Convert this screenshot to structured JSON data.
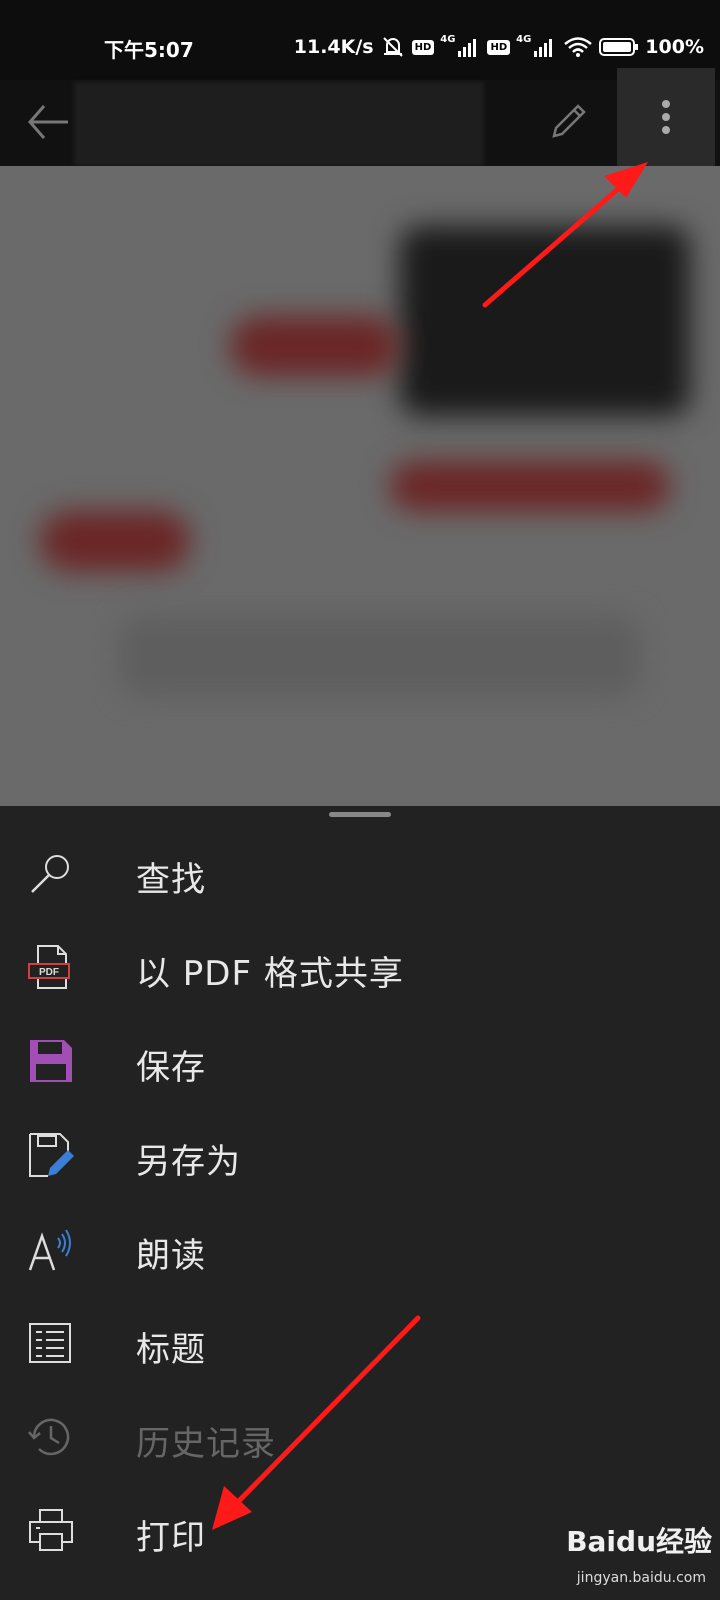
{
  "status_bar": {
    "time": "下午5:07",
    "net_speed": "11.4K/s",
    "hd_badge": "HD",
    "network_type": "4G",
    "battery_percent": "100%"
  },
  "toolbar": {
    "icons": [
      "back-arrow-icon",
      "pencil-icon",
      "more-vert-icon"
    ]
  },
  "menu": {
    "items": [
      {
        "label": "查找",
        "icon": "search-icon",
        "enabled": true
      },
      {
        "label": "以 PDF 格式共享",
        "icon": "pdf-icon",
        "enabled": true
      },
      {
        "label": "保存",
        "icon": "save-icon",
        "enabled": true
      },
      {
        "label": "另存为",
        "icon": "save-as-icon",
        "enabled": true
      },
      {
        "label": "朗读",
        "icon": "read-aloud-icon",
        "enabled": true
      },
      {
        "label": "标题",
        "icon": "headings-icon",
        "enabled": true
      },
      {
        "label": "历史记录",
        "icon": "history-icon",
        "enabled": false
      },
      {
        "label": "打印",
        "icon": "print-icon",
        "enabled": true
      }
    ],
    "pdf_icon_text": "PDF"
  },
  "watermark": {
    "brand": "Baidu经验",
    "url": "jingyan.baidu.com"
  },
  "colors": {
    "save_icon": "#a24fb5",
    "save_as_pen": "#3a7fd5",
    "read_aloud_waves": "#3a7fd5",
    "pdf_red": "#d04040",
    "annotation_arrow": "#ff1a1a"
  }
}
